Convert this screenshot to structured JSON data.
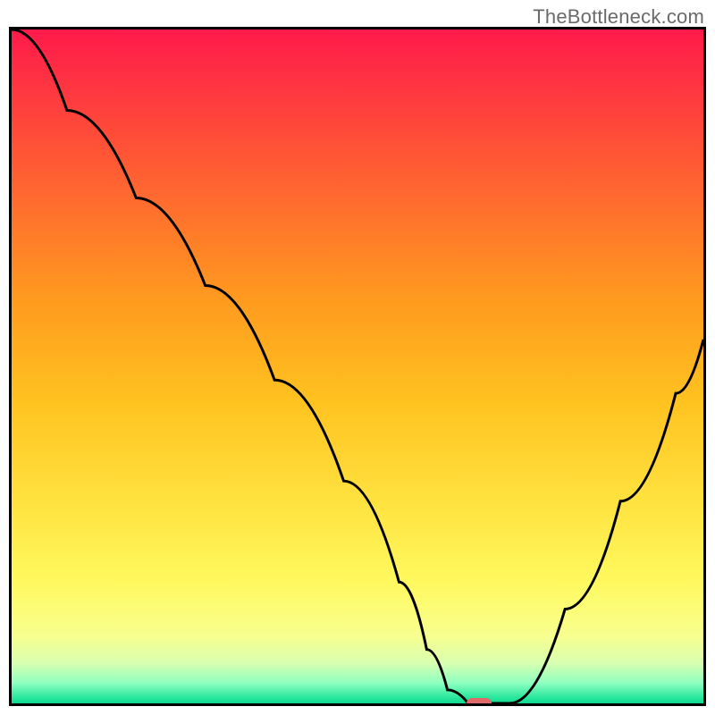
{
  "watermark": "TheBottleneck.com",
  "colors": {
    "gradient_top": "#ff1a4a",
    "gradient_bottom": "#10d890",
    "curve": "#000000",
    "pill": "#e06a6a",
    "border": "#000000"
  },
  "chart_data": {
    "type": "line",
    "title": "",
    "xlabel": "",
    "ylabel": "",
    "xlim": [
      0,
      100
    ],
    "ylim": [
      0,
      100
    ],
    "grid": false,
    "legend": false,
    "series": [
      {
        "name": "curve",
        "x": [
          0,
          8,
          18,
          28,
          38,
          48,
          56,
          60,
          63,
          66,
          72,
          80,
          88,
          96,
          100
        ],
        "y": [
          100,
          88,
          75,
          62,
          48,
          33,
          18,
          8,
          2,
          0,
          0,
          14,
          30,
          46,
          54
        ]
      }
    ],
    "marker": {
      "x": 67,
      "y": 0,
      "shape": "pill",
      "color": "#e06a6a"
    }
  }
}
